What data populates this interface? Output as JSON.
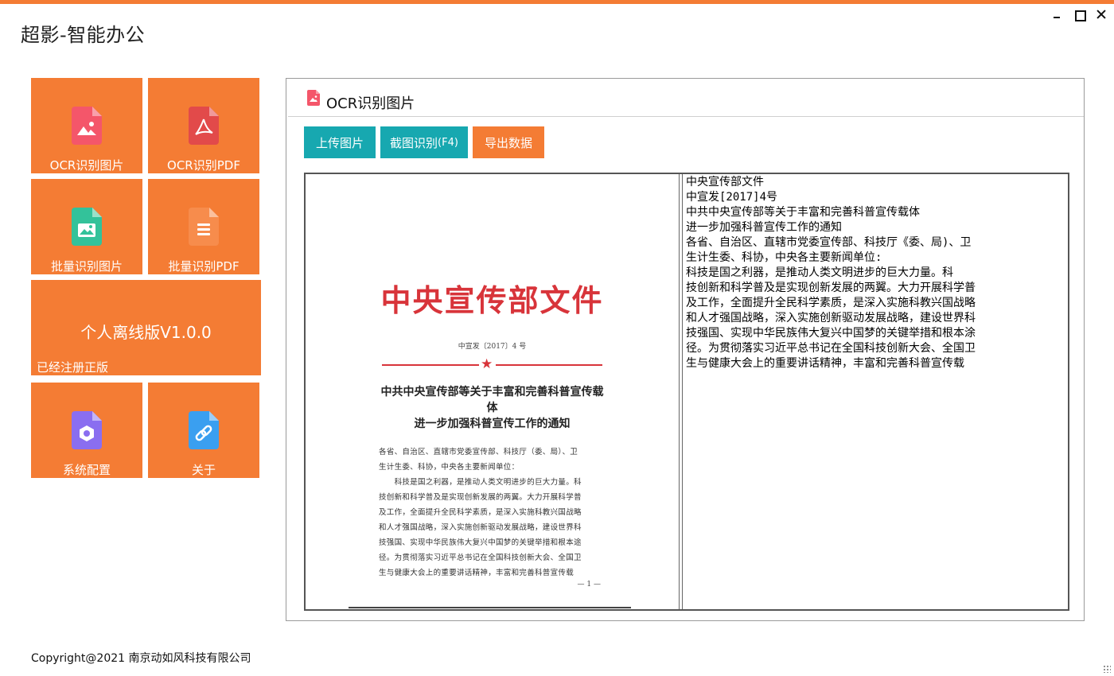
{
  "window": {
    "title": "超影-智能办公",
    "controls": [
      "minimize-icon",
      "maximize-icon",
      "close-icon"
    ],
    "accent_color": "#f47c34"
  },
  "sidebar": {
    "tiles": [
      {
        "label": "OCR识别图片",
        "icon": "image-file-icon",
        "icon_color": "#f4566a"
      },
      {
        "label": "OCR识别PDF",
        "icon": "pdf-file-icon",
        "icon_color": "#e24a4a"
      },
      {
        "label": "批量识别图片",
        "icon": "image-batch-icon",
        "icon_color": "#33c29a"
      },
      {
        "label": "批量识别PDF",
        "icon": "list-file-icon",
        "icon_color": "#f78c4c"
      },
      {
        "label": "系统配置",
        "icon": "settings-file-icon",
        "icon_color": "#8a6ef0"
      },
      {
        "label": "关于",
        "icon": "link-file-icon",
        "icon_color": "#3a9ff0"
      }
    ],
    "version_tile": {
      "version": "个人离线版V1.0.0",
      "status": "已经注册正版"
    }
  },
  "panel": {
    "title": "OCR识别图片",
    "title_icon": "image-file-icon",
    "buttons": {
      "upload": "上传图片",
      "capture": "截图识别",
      "capture_shortcut": "(F4)",
      "export": "导出数据"
    },
    "teal_color": "#17a8b0"
  },
  "document_image": {
    "header": "中央宣传部文件",
    "number": "中宣发〔2017〕4 号",
    "title_line1": "中共中央宣传部等关于丰富和完善科普宣传载体",
    "title_line2": "进一步加强科普宣传工作的通知",
    "body": [
      "各省、自治区、直辖市党委宣传部、科技厅（委、局）、卫",
      "生计生委、科协，中央各主要新闻单位：",
      "　　科技是国之利器，是推动人类文明进步的巨大力量。科",
      "技创新和科学普及是实现创新发展的两翼。大力开展科学普",
      "及工作，全面提升全民科学素质，是深入实施科教兴国战略",
      "和人才强国战略，深入实施创新驱动发展战略，建设世界科",
      "技强国、实现中华民族伟大复兴中国梦的关键举措和根本途",
      "径。为贯彻落实习近平总书记在全国科技创新大会、全国卫",
      "生与健康大会上的重要讲话精神，丰富和完善科普宣传载"
    ],
    "page": "— 1 —"
  },
  "ocr_result": [
    "中央宣传部文件",
    "中宣发[2017]4号",
    "中共中央宣传部等关于丰富和完善科普宣传载体",
    "进一步加强科普宣传工作的通知",
    "各省、自治区、直辖市党委宣传部、科技厅《委、局)、卫",
    "生计生委、科协，中央各主要新闻单位:",
    "科技是国之利器，是推动人类文明进步的巨大力量。科",
    "技创新和科学普及是实现创新发展的两翼。大力开展科学普",
    "及工作，全面提升全民科学素质，是深入实施科教兴国战略",
    "和人才强国战略，深入实施创新驱动发展战略，建设世界科",
    "技强国、实现中华民族伟大复兴中国梦的关键举措和根本涂",
    "径。为贯彻落实习近平总书记在全国科技创新大会、全国卫",
    "生与健康大会上的重要讲话精神，丰富和完善科普宣传载"
  ],
  "footer": {
    "copyright": "Copyright@2021 南京动如风科技有限公司"
  }
}
